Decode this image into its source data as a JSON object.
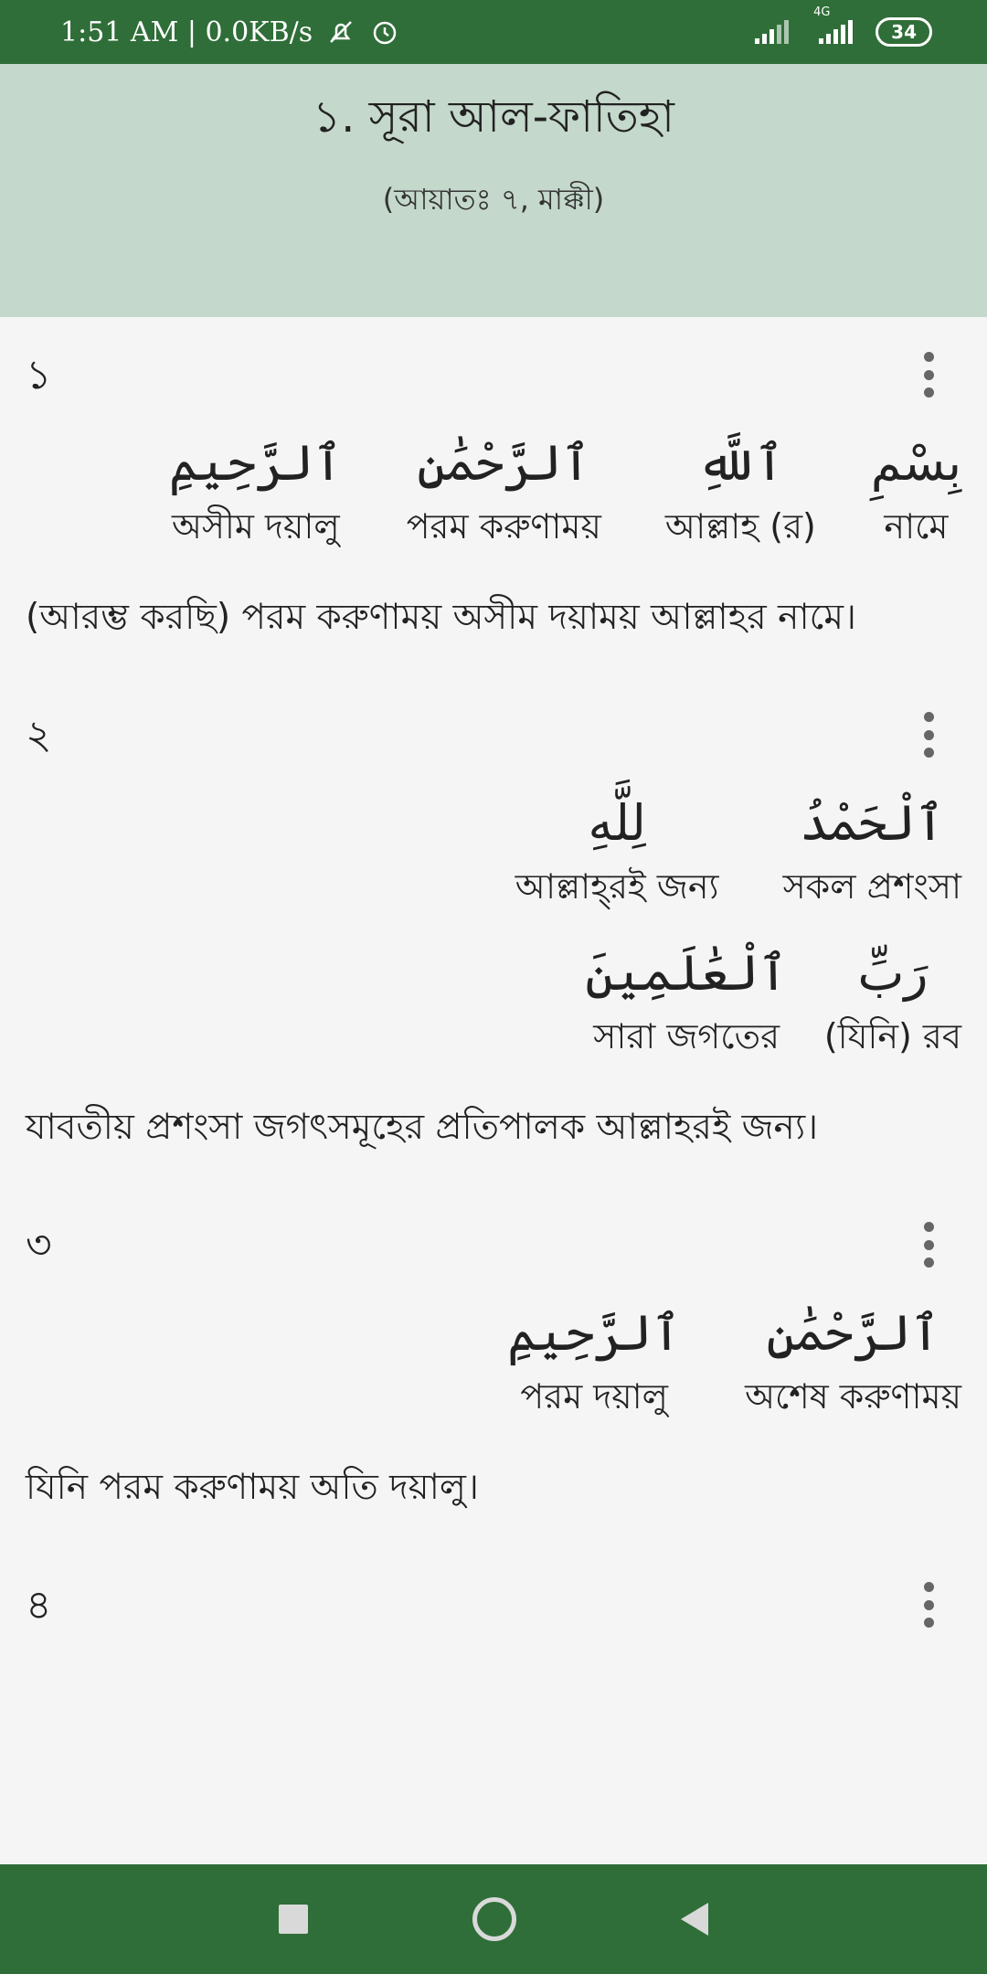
{
  "status_bar": {
    "time_speed": "1:51 AM | 0.0KB/s",
    "network": "4G",
    "battery": "34",
    "icons": [
      "mute-icon",
      "alarm-icon",
      "signal-icon",
      "signal-4g-icon",
      "battery-icon"
    ]
  },
  "header": {
    "title": "১. সূরা আল-ফাতিহা",
    "subtitle": "(আয়াতঃ ৭, মাক্কী)"
  },
  "verses": [
    {
      "number": "১",
      "words": [
        {
          "ar": "بِسْمِ",
          "bn": "নামে"
        },
        {
          "ar": "ٱللَّهِ",
          "bn": "আল্লাহ (র)"
        },
        {
          "ar": "ٱلرَّحْمَٰنِ",
          "bn": "পরম করুণাময়"
        },
        {
          "ar": "ٱلرَّحِيمِ",
          "bn": "অসীম দয়ালু"
        }
      ],
      "translation": "(আরম্ভ করছি) পরম করুণাময় অসীম দয়াময় আল্লাহর নামে।"
    },
    {
      "number": "২",
      "words": [
        {
          "ar": "ٱلْحَمْدُ",
          "bn": "সকল প্রশংসা"
        },
        {
          "ar": "لِلَّهِ",
          "bn": "আল্লাহ্‌রই জন্য"
        },
        {
          "ar": "رَبِّ",
          "bn": "(যিনি) রব"
        },
        {
          "ar": "ٱلْعَٰلَمِينَ",
          "bn": "সারা জগতের"
        }
      ],
      "translation": "যাবতীয় প্রশংসা জগৎসমূহের প্রতিপালক আল্লাহরই জন্য।"
    },
    {
      "number": "৩",
      "words": [
        {
          "ar": "ٱلرَّحْمَٰنِ",
          "bn": "অশেষ করুণাময়"
        },
        {
          "ar": "ٱلرَّحِيمِ",
          "bn": "পরম দয়ালু"
        }
      ],
      "translation": "যিনি পরম করুণাময় অতি দয়ালু।"
    },
    {
      "number": "৪",
      "words": [],
      "translation": ""
    }
  ],
  "nav": {
    "icons": [
      "recents-icon",
      "home-icon",
      "back-icon"
    ]
  },
  "colors": {
    "bar": "#2f6e38",
    "header": "#c4d8cb",
    "background": "#f5f5f5"
  }
}
